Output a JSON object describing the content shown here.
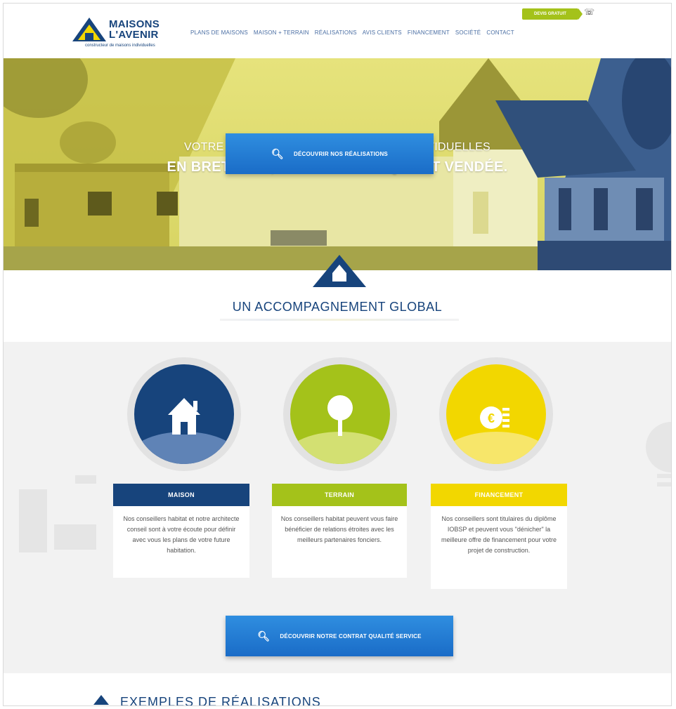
{
  "header": {
    "logo": {
      "line1": "MAISONS",
      "line2": "L'AVENIR",
      "tagline": "constructeur de maisons individuelles"
    },
    "nav": [
      "PLANS DE MAISONS",
      "MAISON + TERRAIN",
      "RÉALISATIONS",
      "AVIS CLIENTS",
      "FINANCEMENT",
      "SOCIÉTÉ",
      "CONTACT"
    ],
    "devis_label": "DEVIS GRATUIT",
    "phone_icon": "phone-icon"
  },
  "hero": {
    "line1": "VOTRE CONSTRUCTEUR DE MAISONS INDIVIDUELLES",
    "line2": "EN BRETAGNE, LOIRE ATLANTIQUE ET VENDÉE.",
    "cta_label": "DÉCOUVRIR NOS RÉALISATIONS"
  },
  "section": {
    "title": "UN ACCOMPAGNEMENT GLOBAL"
  },
  "cards": [
    {
      "title": "MAISON",
      "text": "Nos conseillers habitat et notre architecte conseil sont à votre écoute pour définir avec vous les plans de votre future habitation.",
      "color": "#17447c",
      "icon": "house-icon"
    },
    {
      "title": "TERRAIN",
      "text": "Nos conseillers habitat peuvent vous faire bénéficier de relations étroites avec les meilleurs partenaires fonciers.",
      "color": "#a4c21a",
      "icon": "tree-icon"
    },
    {
      "title": "FINANCEMENT",
      "text": "Nos conseillers sont titulaires du diplôme IOBSP et peuvent vous \"dénicher\" la meilleure offre de financement pour votre projet de construction.",
      "color": "#f2d700",
      "icon": "euro-coin-icon"
    }
  ],
  "contract_cta": "DÉCOUVRIR NOTRE CONTRAT QUALITÉ SERVICE",
  "bottom_title": "EXEMPLES DE RÉALISATIONS",
  "colors": {
    "navy": "#17447c",
    "lime": "#a4c21a",
    "yellow": "#f2d700",
    "button_blue": "#1a6cc7"
  }
}
